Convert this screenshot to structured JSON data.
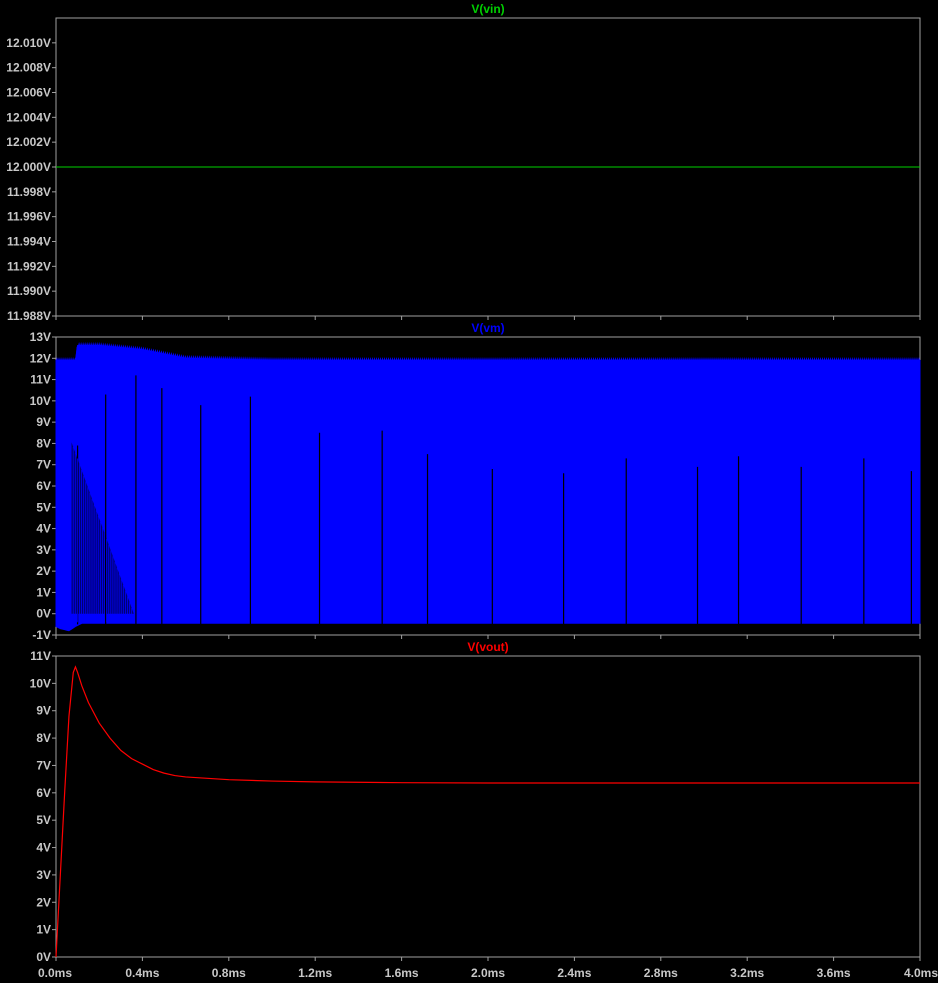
{
  "x_axis": {
    "ticks": [
      "0.0ms",
      "0.4ms",
      "0.8ms",
      "1.2ms",
      "1.6ms",
      "2.0ms",
      "2.4ms",
      "2.8ms",
      "3.2ms",
      "3.6ms",
      "4.0ms"
    ],
    "range_ms": [
      0,
      4.0
    ]
  },
  "colors": {
    "background": "#000000",
    "frame": "#a0a0a0",
    "tick_text": "#c8c8c8",
    "vin": "#00d000",
    "vm": "#0000ff",
    "vout": "#ff0000"
  },
  "chart_data": [
    {
      "type": "line",
      "title": "V(vin)",
      "xlabel": "",
      "ylabel": "",
      "xlim": [
        0,
        4.0
      ],
      "ylim": [
        11.988,
        12.012
      ],
      "y_ticks": [
        "12.010V",
        "12.008V",
        "12.006V",
        "12.004V",
        "12.002V",
        "12.000V",
        "11.998V",
        "11.996V",
        "11.994V",
        "11.992V",
        "11.990V",
        "11.988V"
      ],
      "y_tick_values": [
        12.01,
        12.008,
        12.006,
        12.004,
        12.002,
        12.0,
        11.998,
        11.996,
        11.994,
        11.992,
        11.99,
        11.988
      ],
      "grid": false,
      "series": [
        {
          "name": "V(vin)",
          "color": "#00d000",
          "x": [
            0,
            4.0
          ],
          "y": [
            12.0,
            12.0
          ]
        }
      ]
    },
    {
      "type": "line",
      "title": "V(vm)",
      "xlabel": "",
      "ylabel": "",
      "xlim": [
        0,
        4.0
      ],
      "ylim": [
        -1,
        13
      ],
      "y_ticks": [
        "13V",
        "12V",
        "11V",
        "10V",
        "9V",
        "8V",
        "7V",
        "6V",
        "5V",
        "4V",
        "3V",
        "2V",
        "1V",
        "0V",
        "-1V"
      ],
      "y_tick_values": [
        13,
        12,
        11,
        10,
        9,
        8,
        7,
        6,
        5,
        4,
        3,
        2,
        1,
        0,
        -1
      ],
      "grid": false,
      "description_of_signal": "PWM switching waveform",
      "series": [
        {
          "name": "V(vm)",
          "color": "#0000ff",
          "high_envelope": {
            "x": [
              0,
              0.09,
              0.1,
              0.2,
              0.3,
              0.4,
              0.5,
              0.6,
              0.8,
              1.0,
              4.0
            ],
            "y": [
              11.9,
              11.9,
              12.6,
              12.6,
              12.5,
              12.4,
              12.2,
              12.0,
              11.95,
              11.9,
              11.9
            ]
          },
          "low_envelope": {
            "x": [
              0,
              0.02,
              0.06,
              0.09,
              0.12,
              4.0
            ],
            "y": [
              -0.6,
              -0.7,
              -0.8,
              -0.6,
              -0.45,
              -0.45
            ]
          },
          "dip_spikes_x_ms": [
            0.1,
            0.23,
            0.37,
            0.49,
            0.67,
            0.9,
            1.22,
            1.51,
            1.72,
            2.02,
            2.35,
            2.64,
            2.97,
            3.16,
            3.45,
            3.74,
            3.96
          ],
          "dip_spikes_y": [
            7.9,
            10.3,
            11.2,
            10.6,
            9.8,
            10.2,
            8.5,
            8.6,
            7.5,
            6.8,
            6.6,
            7.3,
            6.9,
            7.4,
            6.9,
            7.3,
            6.7
          ],
          "decay_pulses_ms": [
            0.07,
            0.36
          ],
          "decay_pulses_y": [
            8.1,
            0.0
          ]
        }
      ]
    },
    {
      "type": "line",
      "title": "V(vout)",
      "xlabel": "",
      "ylabel": "",
      "xlim": [
        0,
        4.0
      ],
      "ylim": [
        0,
        11
      ],
      "y_ticks": [
        "11V",
        "10V",
        "9V",
        "8V",
        "7V",
        "6V",
        "5V",
        "4V",
        "3V",
        "2V",
        "1V",
        "0V"
      ],
      "y_tick_values": [
        11,
        10,
        9,
        8,
        7,
        6,
        5,
        4,
        3,
        2,
        1,
        0
      ],
      "grid": false,
      "series": [
        {
          "name": "V(vout)",
          "color": "#ff0000",
          "x": [
            0.0,
            0.02,
            0.04,
            0.06,
            0.08,
            0.09,
            0.1,
            0.12,
            0.15,
            0.2,
            0.25,
            0.3,
            0.35,
            0.4,
            0.45,
            0.5,
            0.55,
            0.6,
            0.7,
            0.8,
            1.0,
            1.2,
            1.6,
            2.0,
            2.4,
            2.8,
            3.2,
            3.6,
            4.0
          ],
          "y": [
            0.0,
            3.0,
            6.0,
            8.8,
            10.4,
            10.6,
            10.4,
            9.9,
            9.3,
            8.55,
            8.0,
            7.55,
            7.25,
            7.05,
            6.85,
            6.72,
            6.63,
            6.58,
            6.53,
            6.48,
            6.43,
            6.4,
            6.37,
            6.36,
            6.36,
            6.36,
            6.36,
            6.36,
            6.36
          ]
        }
      ]
    }
  ]
}
